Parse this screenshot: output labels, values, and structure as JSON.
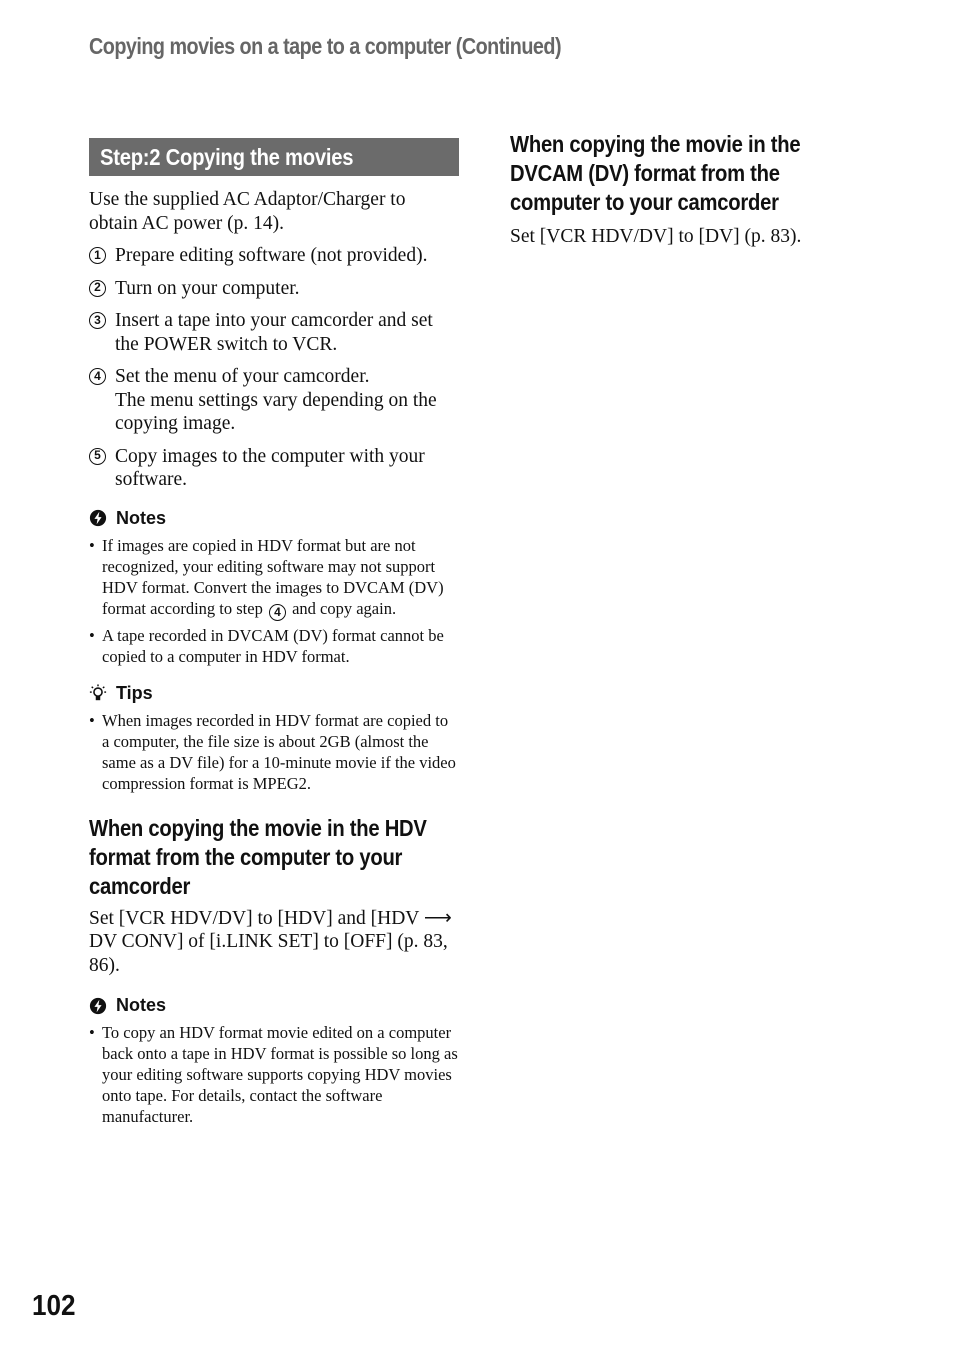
{
  "header": {
    "title": "Copying movies on a tape to a computer (Continued)"
  },
  "step_section": {
    "banner": "Step:2 Copying the movies",
    "intro": "Use the supplied AC Adaptor/Charger to obtain AC power (p. 14).",
    "steps": [
      {
        "num": "1",
        "text": "Prepare editing software (not provided)."
      },
      {
        "num": "2",
        "text": "Turn on your computer."
      },
      {
        "num": "3",
        "text": "Insert a tape into your camcorder and set the POWER switch to VCR."
      },
      {
        "num": "4",
        "text": "Set the menu of your camcorder.",
        "subtext": "The menu settings vary depending on the copying image."
      },
      {
        "num": "5",
        "text": "Copy images to the computer with your software."
      }
    ],
    "notes": {
      "label": "Notes",
      "icon": "notes-icon",
      "items": [
        {
          "before": "If images are copied in HDV format but are not recognized, your editing software may not support HDV format. Convert the images to DVCAM (DV) format according to step",
          "ref": "4",
          "after": "and copy again."
        },
        {
          "text": "A tape recorded in DVCAM (DV) format cannot be copied to a computer in HDV format."
        }
      ]
    },
    "tips": {
      "label": "Tips",
      "icon": "tips-lightbulb-icon",
      "items": [
        "When images recorded in HDV format are copied to a computer, the file size is about 2GB (almost the same as a DV file) for a 10-minute movie if the video compression format is MPEG2."
      ]
    }
  },
  "hdv_section": {
    "heading": "When copying the movie in the HDV format from the computer to your camcorder",
    "body_part1": "Set [VCR HDV/DV] to [HDV] and [HDV",
    "arrow": "⟶",
    "body_part2": "DV CONV] of [i.LINK SET] to [OFF] (p. 83, 86).",
    "notes": {
      "label": "Notes",
      "items": [
        "To copy an HDV format movie edited on a computer back onto a tape in HDV format is possible so long as your editing software supports copying HDV movies onto tape. For details, contact the software manufacturer."
      ]
    }
  },
  "dv_section": {
    "heading": "When copying the movie in the DVCAM (DV) format from the computer to your camcorder",
    "body": "Set [VCR HDV/DV] to [DV] (p. 83)."
  },
  "footer": {
    "page_number": "102"
  }
}
